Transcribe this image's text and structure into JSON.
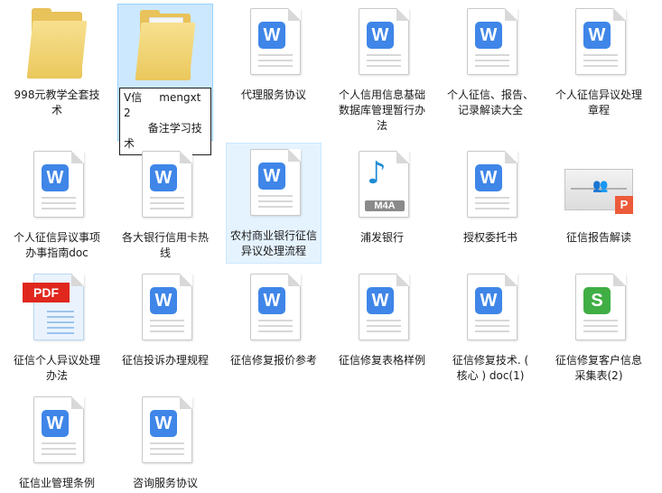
{
  "items": [
    {
      "label": "998元教学全套技术",
      "type": "folder"
    },
    {
      "label": "V信     mengxt2\n       备注学习技术",
      "type": "folder"
    },
    {
      "label": "代理服务协议",
      "type": "word"
    },
    {
      "label": "个人信用信息基础数据库管理暂行办法",
      "type": "word"
    },
    {
      "label": "个人征信、报告、记录解读大全",
      "type": "word"
    },
    {
      "label": "个人征信异议处理章程",
      "type": "word"
    },
    {
      "label": "个人征信异议事项办事指南doc",
      "type": "word"
    },
    {
      "label": "各大银行信用卡热线",
      "type": "word"
    },
    {
      "label": "农村商业银行征信异议处理流程",
      "type": "word"
    },
    {
      "label": "浦发银行",
      "type": "m4a",
      "badge": "M4A"
    },
    {
      "label": "授权委托书",
      "type": "word"
    },
    {
      "label": "征信报告解读",
      "type": "ppt",
      "badge": "P"
    },
    {
      "label": "征信个人异议处理办法",
      "type": "pdf",
      "badge": "PDF"
    },
    {
      "label": "征信投诉办理规程",
      "type": "word"
    },
    {
      "label": "征信修复报价参考",
      "type": "word"
    },
    {
      "label": "征信修复表格样例",
      "type": "word"
    },
    {
      "label": "征信修复技术. ( 核心 ) doc(1)",
      "type": "word"
    },
    {
      "label": "征信修复客户信息采集表(2)",
      "type": "sheet"
    },
    {
      "label": "征信业管理条例",
      "type": "word"
    },
    {
      "label": "咨询服务协议",
      "type": "word"
    }
  ],
  "icon_letters": {
    "word": "W",
    "sheet": "S"
  },
  "colors": {
    "word": "#3f86e8",
    "sheet": "#3fae44",
    "pdf": "#e0271e",
    "selection": "#cce8ff"
  }
}
